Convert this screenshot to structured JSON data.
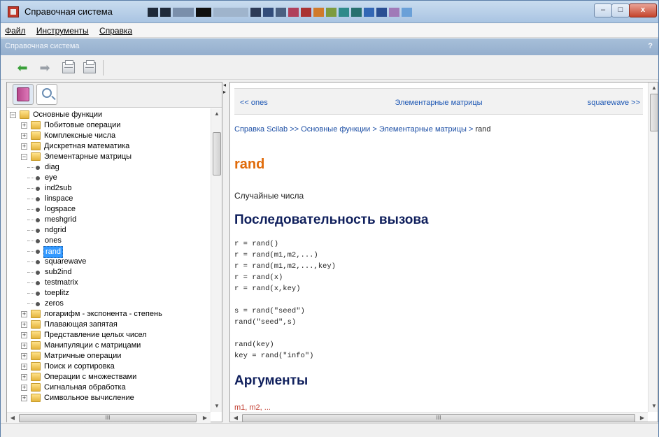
{
  "window": {
    "title": "Справочная система",
    "min_label": "–",
    "max_label": "□",
    "close_label": "x"
  },
  "menu": [
    "Файл",
    "Инструменты",
    "Справка"
  ],
  "panel": {
    "title": "Справочная система",
    "help": "?"
  },
  "toolbar": {
    "back_icon": "back-arrow-icon",
    "forward_icon": "forward-arrow-icon",
    "print_icon": "printer-icon",
    "page_setup_icon": "page-setup-icon"
  },
  "left_tabs": {
    "toc_icon": "book-icon",
    "search_icon": "magnifier-icon"
  },
  "tree": {
    "root": "Основные функции",
    "before": [
      "Побитовые операции",
      "Комплексные числа",
      "Дискретная математика"
    ],
    "open_folder": "Элементарные матрицы",
    "leaves": [
      "diag",
      "eye",
      "ind2sub",
      "linspace",
      "logspace",
      "meshgrid",
      "ndgrid",
      "ones",
      "rand",
      "squarewave",
      "sub2ind",
      "testmatrix",
      "toeplitz",
      "zeros"
    ],
    "selected": "rand",
    "after": [
      "логарифм - экспонента - степень",
      "Плавающая запятая",
      "Представление целых чисел",
      "Манипуляции с матрицами",
      "Матричные операции",
      "Поиск и сортировка",
      "Операции с множествами",
      "Сигнальная обработка",
      "Символьное вычисление"
    ]
  },
  "page": {
    "nav_prev": "<< ones",
    "nav_section": "Элементарные матрицы",
    "nav_next": "squarewave >>",
    "breadcrumb": [
      "Справка Scilab",
      "Основные функции",
      "Элементарные матрицы",
      "rand"
    ],
    "refname": "rand",
    "purpose": "Случайные числа",
    "syntax_heading": "Последовательность вызова",
    "syntax": [
      "r = rand()",
      "r = rand(m1,m2,...)",
      "r = rand(m1,m2,...,key)",
      "r = rand(x)",
      "r = rand(x,key)",
      "",
      "s = rand(\"seed\")",
      "rand(\"seed\",s)",
      "",
      "rand(key)",
      "key = rand(\"info\")"
    ],
    "arguments_heading": "Аргументы",
    "first_argument": "m1, m2, ..."
  },
  "scroll": {
    "left_thumb_label": "III",
    "right_thumb_label": "III"
  },
  "colors": {
    "refname": "#e06b0a",
    "heading": "#0f1f5c",
    "link": "#1d57b4",
    "selection": "#3399ff"
  }
}
